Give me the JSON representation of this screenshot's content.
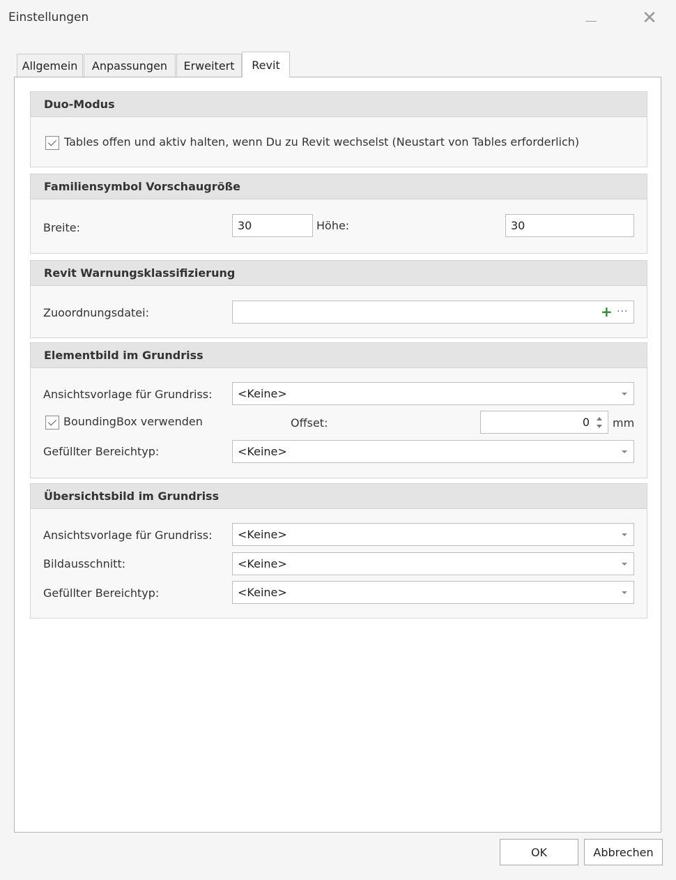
{
  "window": {
    "title": "Einstellungen"
  },
  "tabs": [
    {
      "label": "Allgemein"
    },
    {
      "label": "Anpassungen"
    },
    {
      "label": "Erweitert"
    },
    {
      "label": "Revit"
    }
  ],
  "duo_modus": {
    "header": "Duo-Modus",
    "checkbox_label": "Tables offen und aktiv halten, wenn Du zu Revit wechselst (Neustart von Tables erforderlich)",
    "checked": true
  },
  "familiensymbol": {
    "header": "Familiensymbol Vorschaugröße",
    "width_label": "Breite:",
    "width_value": "30",
    "height_label": "Höhe:",
    "height_value": "30"
  },
  "warnungen": {
    "header": "Revit Warnungsklassifizierung",
    "file_label": "Zuoordnungsdatei:",
    "file_value": "",
    "add_icon": "+",
    "browse_icon": "···"
  },
  "elementbild": {
    "header": "Elementbild im Grundriss",
    "template_label": "Ansichtsvorlage für Grundriss:",
    "template_value": "<Keine>",
    "bbox_label": "BoundingBox verwenden",
    "bbox_checked": true,
    "offset_label": "Offset:",
    "offset_value": "0",
    "offset_unit": "mm",
    "fill_label": "Gefüllter Bereichtyp:",
    "fill_value": "<Keine>"
  },
  "uebersichtsbild": {
    "header": "Übersichtsbild im Grundriss",
    "template_label": "Ansichtsvorlage für Grundriss:",
    "template_value": "<Keine>",
    "crop_label": "Bildausschnitt:",
    "crop_value": "<Keine>",
    "fill_label": "Gefüllter Bereichtyp:",
    "fill_value": "<Keine>"
  },
  "footer": {
    "ok_label": "OK",
    "cancel_label": "Abbrechen"
  }
}
